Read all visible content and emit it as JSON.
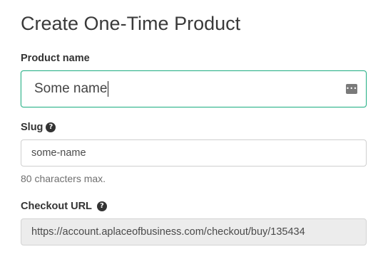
{
  "page": {
    "title": "Create One-Time Product"
  },
  "form": {
    "product_name": {
      "label": "Product name",
      "value": "Some name",
      "autofill_icon": "password-manager-icon"
    },
    "slug": {
      "label": "Slug",
      "value": "some-name",
      "hint": "80 characters max.",
      "help_icon": "question-circle-icon"
    },
    "checkout_url": {
      "label": "Checkout URL",
      "value": "https://account.aplaceofbusiness.com/checkout/buy/135434",
      "help_icon": "question-circle-icon"
    }
  },
  "colors": {
    "focus_border": "#2fb38a",
    "disabled_background": "#ececec",
    "text": "#333333"
  }
}
